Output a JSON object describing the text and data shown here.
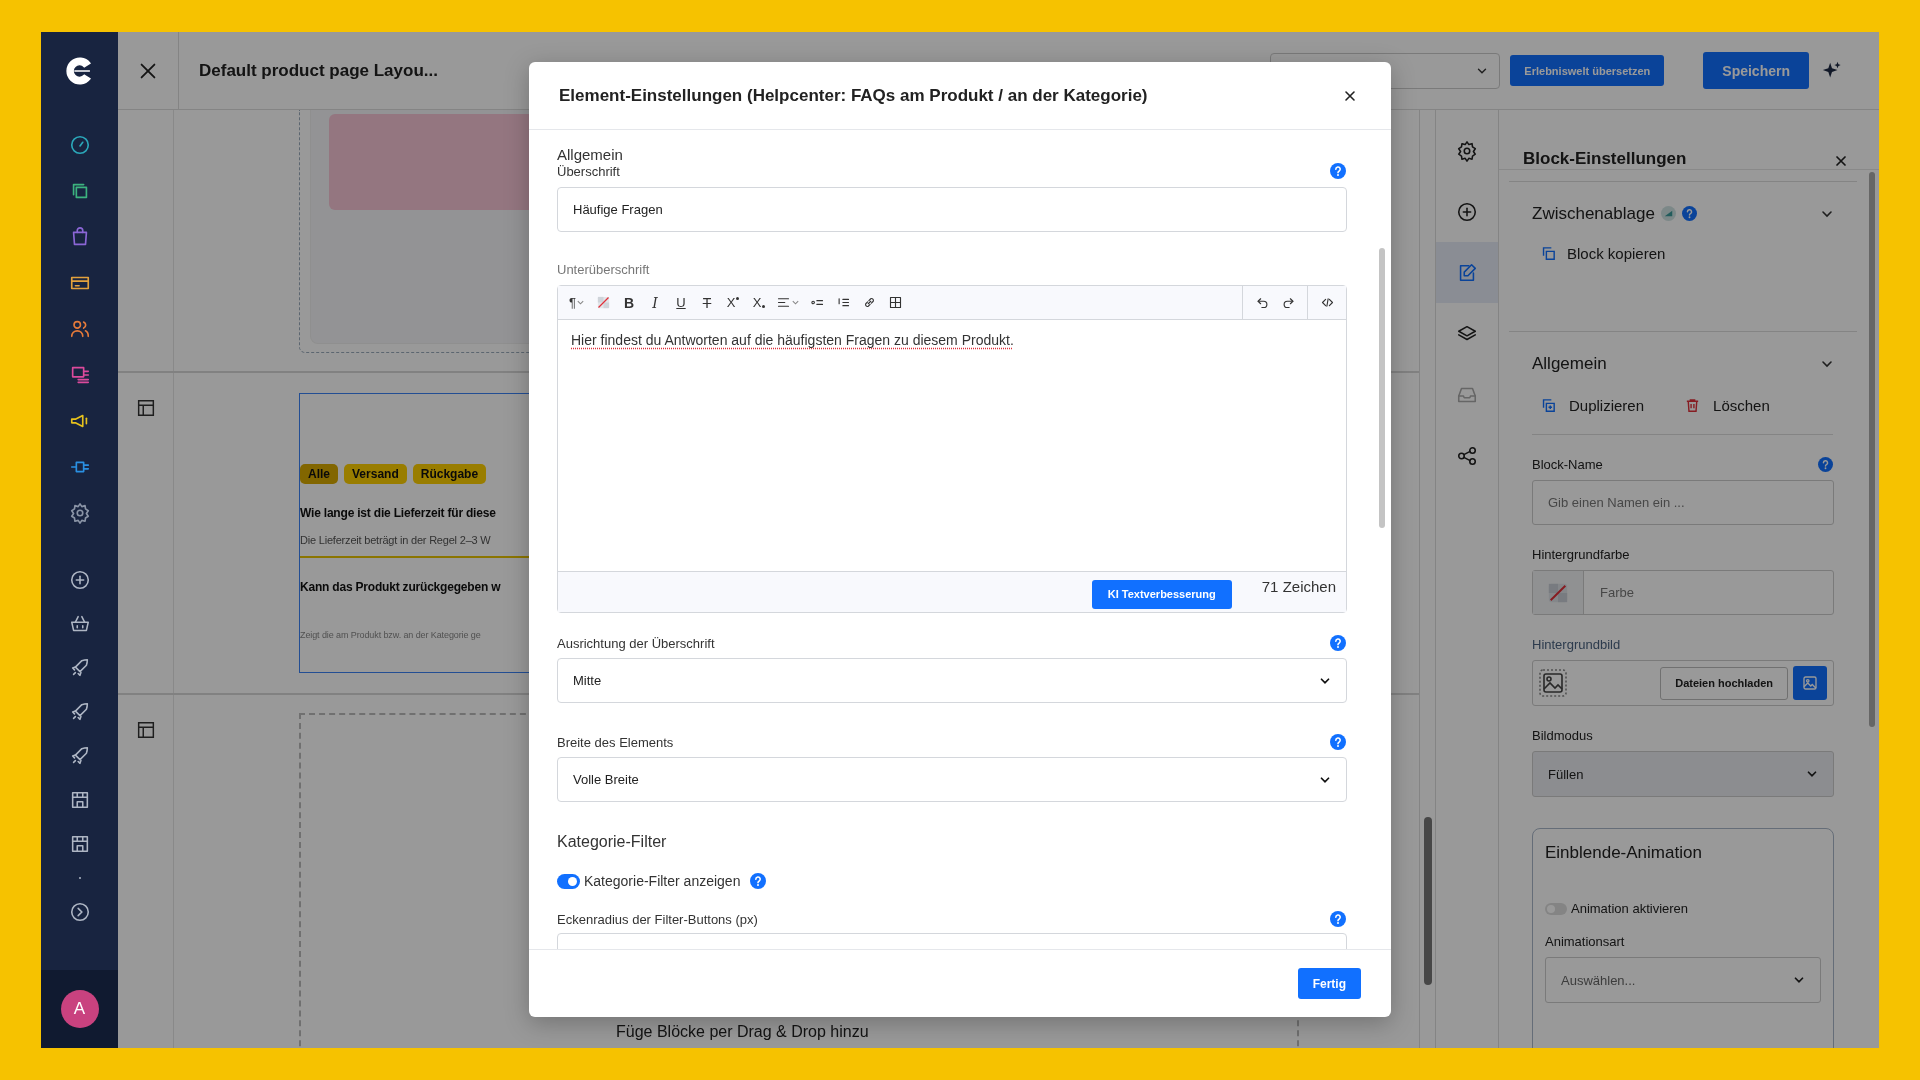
{
  "topbar": {
    "title": "Default product page Layou...",
    "translate_button": "Erlebniswelt übersetzen",
    "save_button": "Speichern"
  },
  "sidebar": {
    "avatar": "A"
  },
  "canvas": {
    "faq_block": {
      "tags": [
        {
          "label": "Alle",
          "selected": true
        },
        {
          "label": "Versand",
          "selected": false
        },
        {
          "label": "Rückgabe",
          "selected": false
        }
      ],
      "items": [
        {
          "question": "Wie lange ist die Lieferzeit für diese",
          "answer": "Die Lieferzeit beträgt in der Regel 2–3 W"
        },
        {
          "question": "Kann das Produkt zurückgegeben w"
        }
      ],
      "note": "Zeigt die am Produkt bzw. an der Kategorie ge"
    },
    "drop_hint": "Füge Blöcke per Drag & Drop hinzu"
  },
  "rail": [
    {
      "kind": "settings",
      "selected": false,
      "disabled": false
    },
    {
      "kind": "add",
      "selected": false,
      "disabled": false
    },
    {
      "kind": "edit",
      "selected": true,
      "disabled": false
    },
    {
      "kind": "layers",
      "selected": false,
      "disabled": false
    },
    {
      "kind": "inbox",
      "selected": false,
      "disabled": true
    },
    {
      "kind": "share",
      "selected": false,
      "disabled": false
    }
  ],
  "panel": {
    "title": "Block-Einstellungen",
    "clipboard": {
      "title": "Zwischenablage",
      "expanded": true,
      "copy_action": "Block kopieren"
    },
    "general": {
      "title": "Allgemein",
      "expanded": true,
      "duplicate_action": "Duplizieren",
      "delete_action": "Löschen",
      "block_name": {
        "label": "Block-Name",
        "placeholder": "Gib einen Namen ein ..."
      },
      "background_color": {
        "label": "Hintergrundfarbe",
        "placeholder": "Farbe"
      },
      "background_image": {
        "label": "Hintergrundbild",
        "upload_button": "Dateien hochladen"
      },
      "image_mode": {
        "label": "Bildmodus",
        "value": "Füllen"
      },
      "animation": {
        "title": "Einblende-Animation",
        "toggle": {
          "label": "Animation aktivieren",
          "on": false
        },
        "type": {
          "label": "Animationsart",
          "placeholder": "Auswählen..."
        }
      }
    }
  },
  "modal": {
    "title": "Element-Einstellungen (Helpcenter: FAQs am Produkt / an der Kategorie)",
    "section": "Allgemein",
    "heading": {
      "label": "Überschrift",
      "value": "Häufige Fragen"
    },
    "subheading": {
      "label": "Unterüberschrift",
      "toolbar": {
        "format": [
          {
            "kind": "paragraph",
            "label": "¶"
          },
          {
            "kind": "clear_format"
          },
          {
            "kind": "bold",
            "label": "B"
          },
          {
            "kind": "italic",
            "label": "I"
          },
          {
            "kind": "underline",
            "label": "U"
          },
          {
            "kind": "strike",
            "label": "T"
          },
          {
            "kind": "superscript",
            "label": "X"
          },
          {
            "kind": "subscript",
            "label": "X"
          },
          {
            "kind": "align"
          },
          {
            "kind": "bullet_list"
          },
          {
            "kind": "numbered_list"
          },
          {
            "kind": "link"
          },
          {
            "kind": "table"
          }
        ],
        "history": [
          {
            "kind": "undo"
          },
          {
            "kind": "redo"
          }
        ],
        "source": [
          {
            "kind": "code"
          }
        ]
      },
      "text": "Hier findest du Antworten auf die häufigsten Fragen zu diesem Produkt.",
      "ai_button": "KI Textverbesserung",
      "char_count": "71 Zeichen"
    },
    "alignment": {
      "label": "Ausrichtung der Überschrift",
      "value": "Mitte"
    },
    "width": {
      "label": "Breite des Elements",
      "value": "Volle Breite"
    },
    "filter_section": "Kategorie-Filter",
    "filter_toggle": {
      "label": "Kategorie-Filter anzeigen",
      "on": true
    },
    "radius": {
      "label": "Eckenradius der Filter-Buttons (px)"
    },
    "done_button": "Fertig"
  }
}
